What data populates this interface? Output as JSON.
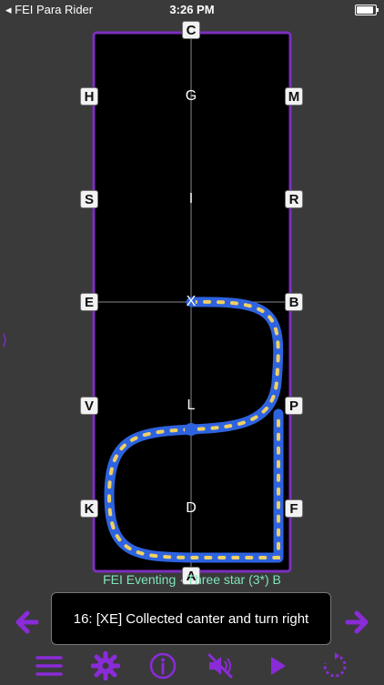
{
  "status_bar": {
    "back_app": "FEI Para Rider",
    "time": "3:26 PM",
    "battery_level": 0.92
  },
  "arena": {
    "markers": {
      "c": "C",
      "a": "A",
      "h": "H",
      "m": "M",
      "s": "S",
      "r": "R",
      "e": "E",
      "b": "B",
      "v": "V",
      "p": "P",
      "k": "K",
      "f": "F"
    },
    "centerline": {
      "g": "G",
      "i": "I",
      "x": "X",
      "l": "L",
      "d": "D"
    },
    "colors": {
      "border": "#7b2fbe",
      "surface": "#000000",
      "path": "#2e63e0",
      "path_dots": "#f0d060"
    }
  },
  "test": {
    "title": "FEI Eventing  ·  Three star (3*) B"
  },
  "movement": {
    "text": "16: [XE] Collected canter and turn right"
  },
  "controls": {
    "accent": "#8a2bd8",
    "icons": [
      "menu-icon",
      "gear-icon",
      "info-icon",
      "mute-icon",
      "play-icon",
      "restart-icon"
    ]
  }
}
